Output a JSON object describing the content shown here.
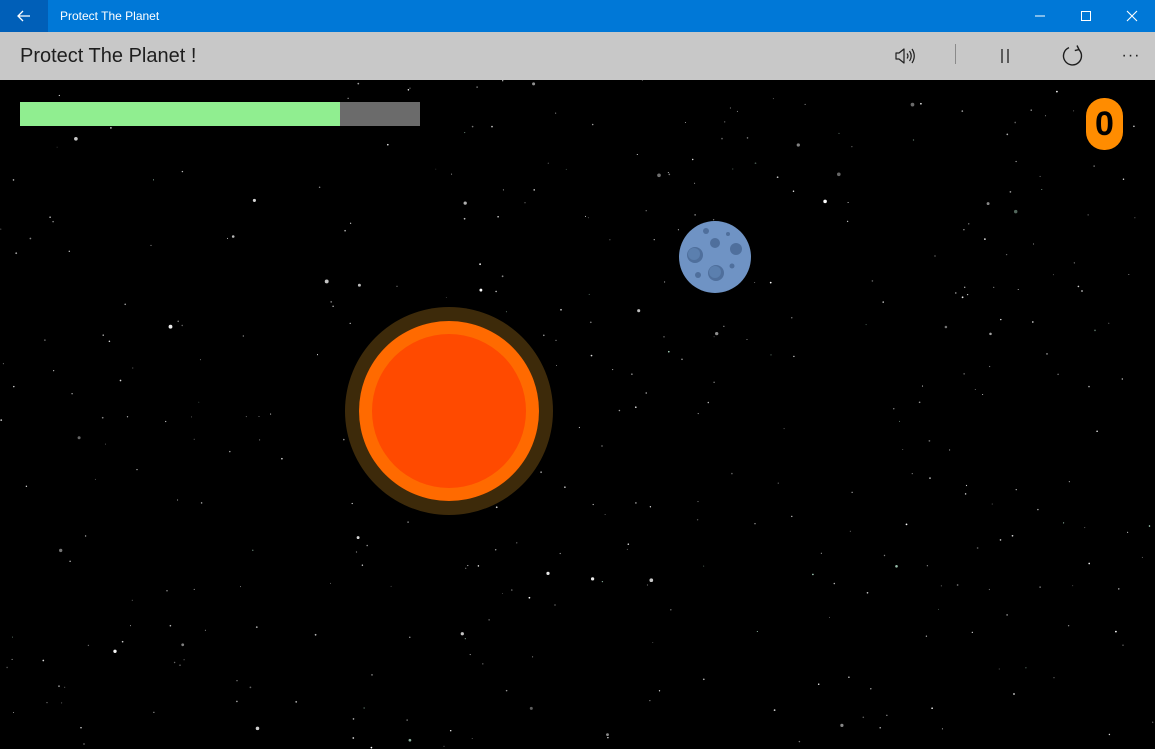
{
  "window": {
    "title": "Protect The Planet",
    "back_icon": "back-arrow-icon",
    "minimize_icon": "minimize-icon",
    "maximize_icon": "maximize-icon",
    "close_icon": "close-icon"
  },
  "command_bar": {
    "title": "Protect The Planet !",
    "sound_icon": "speaker-icon",
    "pause_icon": "pause-icon",
    "restart_icon": "restart-icon",
    "more_icon": "more-icon",
    "more_label": "···"
  },
  "game": {
    "health_fraction": 0.8,
    "health_color": "#90ee90",
    "health_track_color": "#6b6b6b",
    "score": "0",
    "score_color": "#ff8c00",
    "planet_color": "#ff4a00",
    "planet_ring_color": "#ff6a00",
    "planet_glow_color": "#3d2a0a",
    "asteroid_color": "#6f93c4",
    "background_color": "#000000",
    "titlebar_color": "#0078d7",
    "command_bar_color": "#c8c8c8"
  }
}
